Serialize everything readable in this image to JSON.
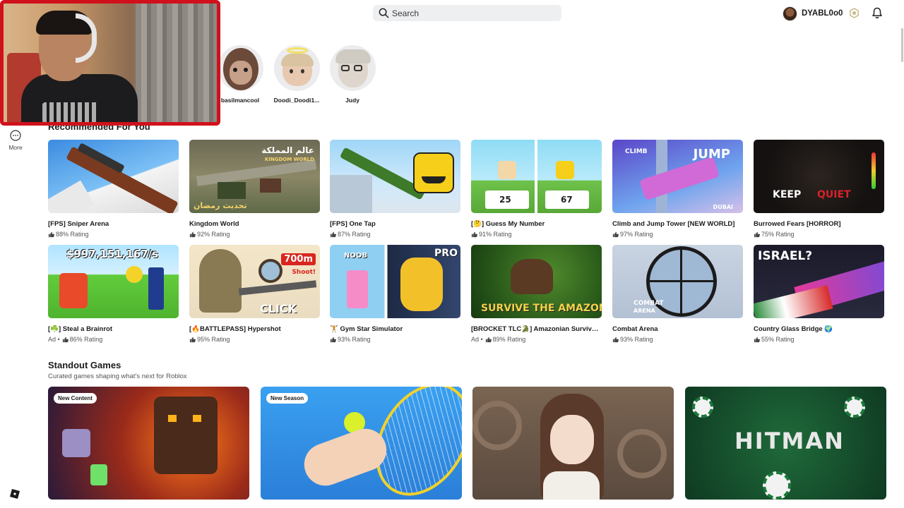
{
  "header": {
    "search_placeholder": "Search",
    "username": "DYABL0o0"
  },
  "sidebar": {
    "more_label": "More"
  },
  "friends": [
    {
      "name": "basilmancool"
    },
    {
      "name": "Doodi_Doodi1..."
    },
    {
      "name": "Judy"
    }
  ],
  "recommended": {
    "title": "Recommended For You",
    "games": [
      {
        "name": "[FPS] Sniper Arena",
        "rating": "88% Rating",
        "ad": ""
      },
      {
        "name": "Kingdom World",
        "rating": "92% Rating",
        "ad": "",
        "thumb_text": "عالم المملكة",
        "thumb_sub": "KINGDOM WORLD",
        "thumb_bottom": "تحديث رمضان"
      },
      {
        "name": "[FPS] One Tap",
        "rating": "87% Rating",
        "ad": ""
      },
      {
        "name": "[🤔] Guess My Number",
        "rating": "91% Rating",
        "ad": "",
        "thumb_n1": "25",
        "thumb_n2": "67"
      },
      {
        "name": "Climb and Jump Tower [NEW WORLD]",
        "rating": "97% Rating",
        "ad": "",
        "thumb_text": "JUMP",
        "thumb_sub": "CLIMB",
        "thumb_bottom": "DUBAI"
      },
      {
        "name": "Burrowed Fears [HORROR]",
        "rating": "75% Rating",
        "ad": "",
        "thumb_text": "KEEP",
        "thumb_sub": "QUIET"
      },
      {
        "name": "[☘️] Steal a Brainrot",
        "rating": "86% Rating",
        "ad": "Ad •",
        "thumb_text": "$997,151,167/s"
      },
      {
        "name": "[🔥BATTLEPASS] Hypershot",
        "rating": "95% Rating",
        "ad": "",
        "thumb_text": "700m",
        "thumb_sub": "Shoot!",
        "thumb_bottom": "CLICK"
      },
      {
        "name": "🏋️ Gym Star Simulator",
        "rating": "93% Rating",
        "ad": "",
        "thumb_text": "NOOB",
        "thumb_sub": "PRO"
      },
      {
        "name": "[BROCKET TLC🐊] Amazonian Survival ...",
        "rating": "89% Rating",
        "ad": "Ad •",
        "thumb_text": "SURVIVE THE AMAZON"
      },
      {
        "name": "Combat Arena",
        "rating": "93% Rating",
        "ad": "",
        "thumb_text": "COMBAT",
        "thumb_sub": "ARENA"
      },
      {
        "name": "Country Glass Bridge 🌍",
        "rating": "55% Rating",
        "ad": "",
        "thumb_text": "ISRAEL?"
      }
    ]
  },
  "standout": {
    "title": "Standout Games",
    "subtitle": "Curated games shaping what's next for Roblox",
    "items": [
      {
        "badge": "New Content"
      },
      {
        "badge": "New Season"
      },
      {
        "badge": ""
      },
      {
        "badge": "",
        "thumb_text": "HITMAN"
      }
    ]
  }
}
